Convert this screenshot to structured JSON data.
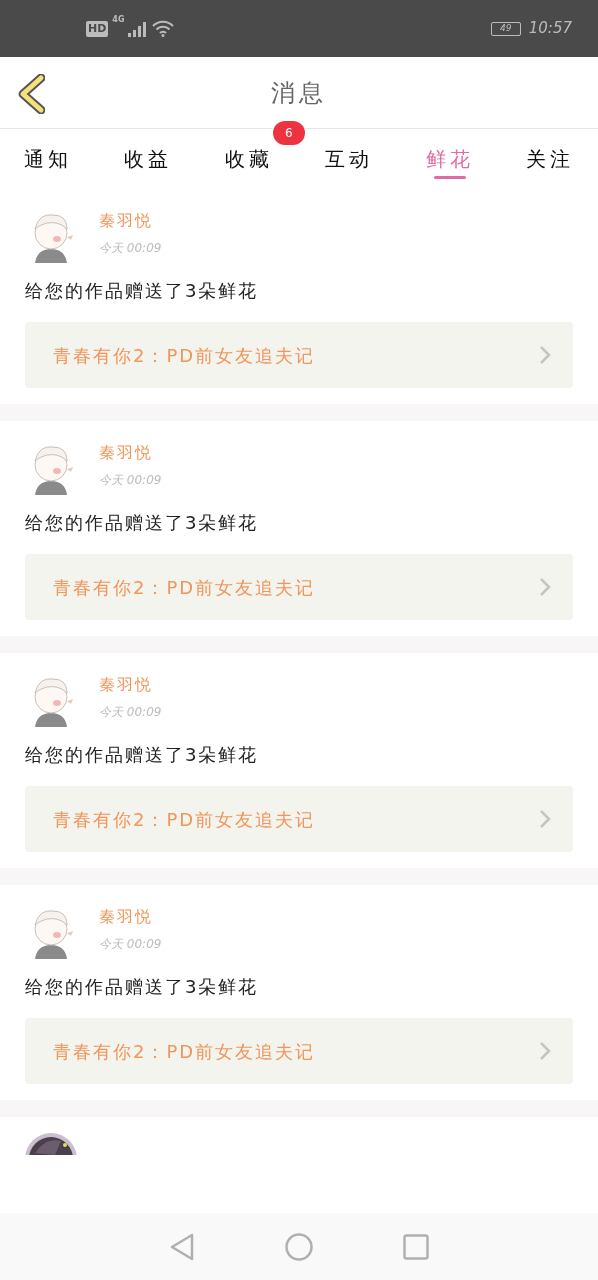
{
  "status_bar": {
    "network_badge": "HD",
    "network_type": "4G",
    "battery": "49",
    "time": "10:57"
  },
  "header": {
    "title": "消息"
  },
  "tabs": [
    {
      "label": "通知",
      "selected": false
    },
    {
      "label": "收益",
      "selected": false
    },
    {
      "label": "收藏",
      "selected": false,
      "badge": "6"
    },
    {
      "label": "互动",
      "selected": false
    },
    {
      "label": "鲜花",
      "selected": true
    },
    {
      "label": "关注",
      "selected": false
    }
  ],
  "messages": [
    {
      "name": "秦羽悦",
      "time": "今天 00:09",
      "text": "给您的作品赠送了3朵鲜花",
      "book": "青春有你2：PD前女友追夫记"
    },
    {
      "name": "秦羽悦",
      "time": "今天 00:09",
      "text": "给您的作品赠送了3朵鲜花",
      "book": "青春有你2：PD前女友追夫记"
    },
    {
      "name": "秦羽悦",
      "time": "今天 00:09",
      "text": "给您的作品赠送了3朵鲜花",
      "book": "青春有你2：PD前女友追夫记"
    },
    {
      "name": "秦羽悦",
      "time": "今天 00:09",
      "text": "给您的作品赠送了3朵鲜花",
      "book": "青春有你2：PD前女友追夫记"
    }
  ]
}
